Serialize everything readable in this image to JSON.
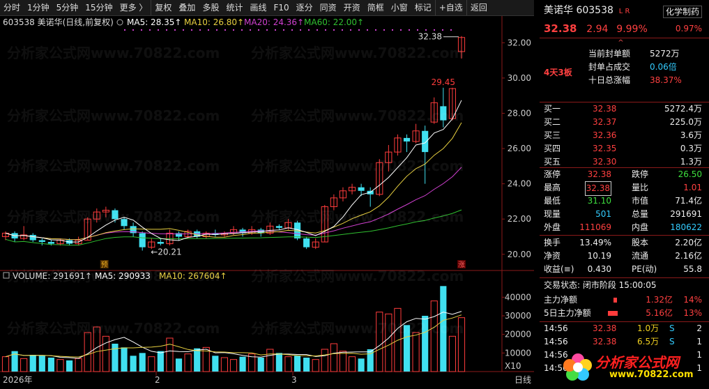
{
  "toolbar": [
    "分时",
    "1分钟",
    "5分钟",
    "15分钟",
    "更多 〉",
    "复权",
    "叠加",
    "多股",
    "统计",
    "画线",
    "F10",
    "逐分",
    "同资",
    "开资",
    "简框",
    "小窗",
    "标记",
    "+自选",
    "返回"
  ],
  "chart_header": {
    "code_name": "603538 美诺华(日线,前复权)",
    "ma5": "MA5: 28.35",
    "ma10": "MA10: 26.80",
    "ma20": "MA20: 24.36",
    "ma60": "MA60: 22.00"
  },
  "volume_header": {
    "vol": "VOLUME: 291691",
    "ma5": "MA5: 290933",
    "ma10": "MA10: 267604"
  },
  "annotations": {
    "high_label": "32.38",
    "peak_label": "29.45",
    "low_label": "←20.21",
    "yu_badge": "预",
    "zhang_badge": "涨",
    "vol_unit": "X10"
  },
  "x_axis": [
    "2026年",
    "2",
    "3",
    "日线"
  ],
  "colors": {
    "up": "#ff3c3c",
    "down": "#40e0f0",
    "ma5": "#ffffff",
    "ma10": "#e8d040",
    "ma20": "#d040d0",
    "ma60": "#30c030"
  },
  "chart_data": {
    "type": "candlestick",
    "price_ylim": [
      19.2,
      33.2
    ],
    "price_ticks": [
      20,
      22,
      24,
      26,
      28,
      30,
      32
    ],
    "volume_ylim": [
      0,
      48000
    ],
    "volume_ticks": [
      10000,
      20000,
      30000,
      40000
    ],
    "candles": [
      [
        21.0,
        21.2,
        21.3,
        20.8
      ],
      [
        21.2,
        20.9,
        21.3,
        20.7
      ],
      [
        20.9,
        21.1,
        21.6,
        20.8
      ],
      [
        21.1,
        20.8,
        21.2,
        20.7
      ],
      [
        20.8,
        20.7,
        20.9,
        20.5
      ],
      [
        20.7,
        20.6,
        20.8,
        20.5
      ],
      [
        20.6,
        20.8,
        20.9,
        20.5
      ],
      [
        20.8,
        20.6,
        20.9,
        20.5
      ],
      [
        20.6,
        20.8,
        21.0,
        20.5
      ],
      [
        20.8,
        22.0,
        22.1,
        20.8
      ],
      [
        22.0,
        22.4,
        22.6,
        21.8
      ],
      [
        22.4,
        22.5,
        22.7,
        22.1
      ],
      [
        22.5,
        22.0,
        22.6,
        21.8
      ],
      [
        22.0,
        21.6,
        22.1,
        21.4
      ],
      [
        21.6,
        21.2,
        21.8,
        21.0
      ],
      [
        21.2,
        20.4,
        21.3,
        20.21
      ],
      [
        20.4,
        20.7,
        20.9,
        20.3
      ],
      [
        20.7,
        20.6,
        20.9,
        20.5
      ],
      [
        20.6,
        21.2,
        21.4,
        20.5
      ],
      [
        21.2,
        21.0,
        21.3,
        20.8
      ],
      [
        21.0,
        21.3,
        21.4,
        20.9
      ],
      [
        21.3,
        21.0,
        21.4,
        20.9
      ],
      [
        21.0,
        21.2,
        21.3,
        20.9
      ],
      [
        21.2,
        21.1,
        21.4,
        21.0
      ],
      [
        21.1,
        21.2,
        21.3,
        21.0
      ],
      [
        21.2,
        21.4,
        21.6,
        21.1
      ],
      [
        21.4,
        21.2,
        21.5,
        21.0
      ],
      [
        21.2,
        21.4,
        21.6,
        21.1
      ],
      [
        21.4,
        21.2,
        21.5,
        21.0
      ],
      [
        21.2,
        21.6,
        21.8,
        21.1
      ],
      [
        21.6,
        21.5,
        21.7,
        21.4
      ],
      [
        21.5,
        21.8,
        22.0,
        21.4
      ],
      [
        21.8,
        20.9,
        21.9,
        20.8
      ],
      [
        20.9,
        20.4,
        21.0,
        20.3
      ],
      [
        20.4,
        20.7,
        20.9,
        20.3
      ],
      [
        20.7,
        22.7,
        22.8,
        20.7
      ],
      [
        22.7,
        23.2,
        23.4,
        22.5
      ],
      [
        23.2,
        23.6,
        23.8,
        23.0
      ],
      [
        23.6,
        23.8,
        24.0,
        23.4
      ],
      [
        23.8,
        23.6,
        24.0,
        23.3
      ],
      [
        23.6,
        23.4,
        23.8,
        22.7
      ],
      [
        23.4,
        25.2,
        25.4,
        23.3
      ],
      [
        25.2,
        25.8,
        26.2,
        24.7
      ],
      [
        25.8,
        26.6,
        26.8,
        25.6
      ],
      [
        26.6,
        26.4,
        26.8,
        25.8
      ],
      [
        26.4,
        27.0,
        27.4,
        26.3
      ],
      [
        27.0,
        25.8,
        27.3,
        24.0
      ],
      [
        27.5,
        28.6,
        28.9,
        27.4
      ],
      [
        28.4,
        27.6,
        29.45,
        27.2
      ],
      [
        27.7,
        29.4,
        29.45,
        27.6
      ],
      [
        31.5,
        32.3,
        32.38,
        31.1
      ]
    ],
    "volume": [
      8000,
      11000,
      7000,
      9000,
      8500,
      7500,
      6500,
      6000,
      7000,
      21000,
      24000,
      19000,
      15000,
      13000,
      8500,
      10000,
      8000,
      11000,
      18000,
      7000,
      9500,
      12500,
      13000,
      8500,
      7500,
      6500,
      8000,
      9500,
      7500,
      12000,
      10000,
      8000,
      8500,
      7500,
      6500,
      12000,
      15000,
      11000,
      8000,
      7000,
      12000,
      32000,
      31000,
      34000,
      25000,
      21000,
      30000,
      38000,
      46000,
      19000,
      29000
    ],
    "ma_values_last": {
      "MA5": 28.35,
      "MA10": 26.8,
      "MA20": 24.36,
      "MA60": 22.0
    }
  },
  "right_panel": {
    "title": "美诺华 603538",
    "title_badge": "L R",
    "sector": "化学制药",
    "price": "32.38",
    "change": "2.94",
    "change_pct": "9.99%",
    "sector_pct": "0.97%",
    "board_label": "4天3板",
    "seal_rows": [
      {
        "label": "当前封单额",
        "value": "5272万"
      },
      {
        "label": "封单占成交",
        "value": "0.06倍"
      },
      {
        "label": "十日总涨幅",
        "value": "38.37%"
      }
    ],
    "bids": [
      {
        "label": "买一",
        "price": "32.38",
        "vol": "5272.4万"
      },
      {
        "label": "买二",
        "price": "32.37",
        "vol": "225.0万"
      },
      {
        "label": "买三",
        "price": "32.36",
        "vol": "3.6万"
      },
      {
        "label": "买四",
        "price": "32.35",
        "vol": "0.3万"
      },
      {
        "label": "买五",
        "price": "32.30",
        "vol": "1.3万"
      }
    ],
    "stats": [
      {
        "l1": "涨停",
        "v1": "32.38",
        "l2": "跌停",
        "v2": "26.50"
      },
      {
        "l1": "最高",
        "v1": "32.38",
        "l2": "量比",
        "v2": "1.01"
      },
      {
        "l1": "最低",
        "v1": "31.10",
        "l2": "市值",
        "v2": "71.4亿"
      },
      {
        "l1": "现量",
        "v1": "501",
        "l2": "总量",
        "v2": "291691"
      },
      {
        "l1": "外盘",
        "v1": "111069",
        "l2": "内盘",
        "v2": "180622"
      }
    ],
    "stats2": [
      {
        "l1": "换手",
        "v1": "13.49%",
        "l2": "股本",
        "v2": "2.20亿"
      },
      {
        "l1": "净资",
        "v1": "10.19",
        "l2": "流通",
        "v2": "2.16亿"
      },
      {
        "l1": "收益(≡)",
        "v1": "0.430",
        "l2": "PE(动)",
        "v2": "55.8"
      }
    ],
    "trade_status": "交易状态: 闭市阶段 15:00:05",
    "flows": [
      {
        "label": "主力净额",
        "value": "1.32亿",
        "pct": "14%"
      },
      {
        "label": "5日主力净额",
        "value": "5.16亿",
        "pct": "13%"
      }
    ],
    "ticks": [
      {
        "time": "14:56",
        "price": "32.38",
        "vol": "1.0万",
        "side": "S",
        "n": "2"
      },
      {
        "time": "14:56",
        "price": "32.38",
        "vol": "6.5万",
        "side": "S",
        "n": "1"
      },
      {
        "time": "14:56",
        "price": "",
        "vol": "",
        "side": "",
        "n": "1"
      },
      {
        "time": "14:56",
        "price": "",
        "vol": "",
        "side": "",
        "n": "1"
      }
    ],
    "logo_text": "分析家公式网",
    "logo_url": "www.70822.com"
  },
  "watermark": "分析家公式网www.70822.com"
}
